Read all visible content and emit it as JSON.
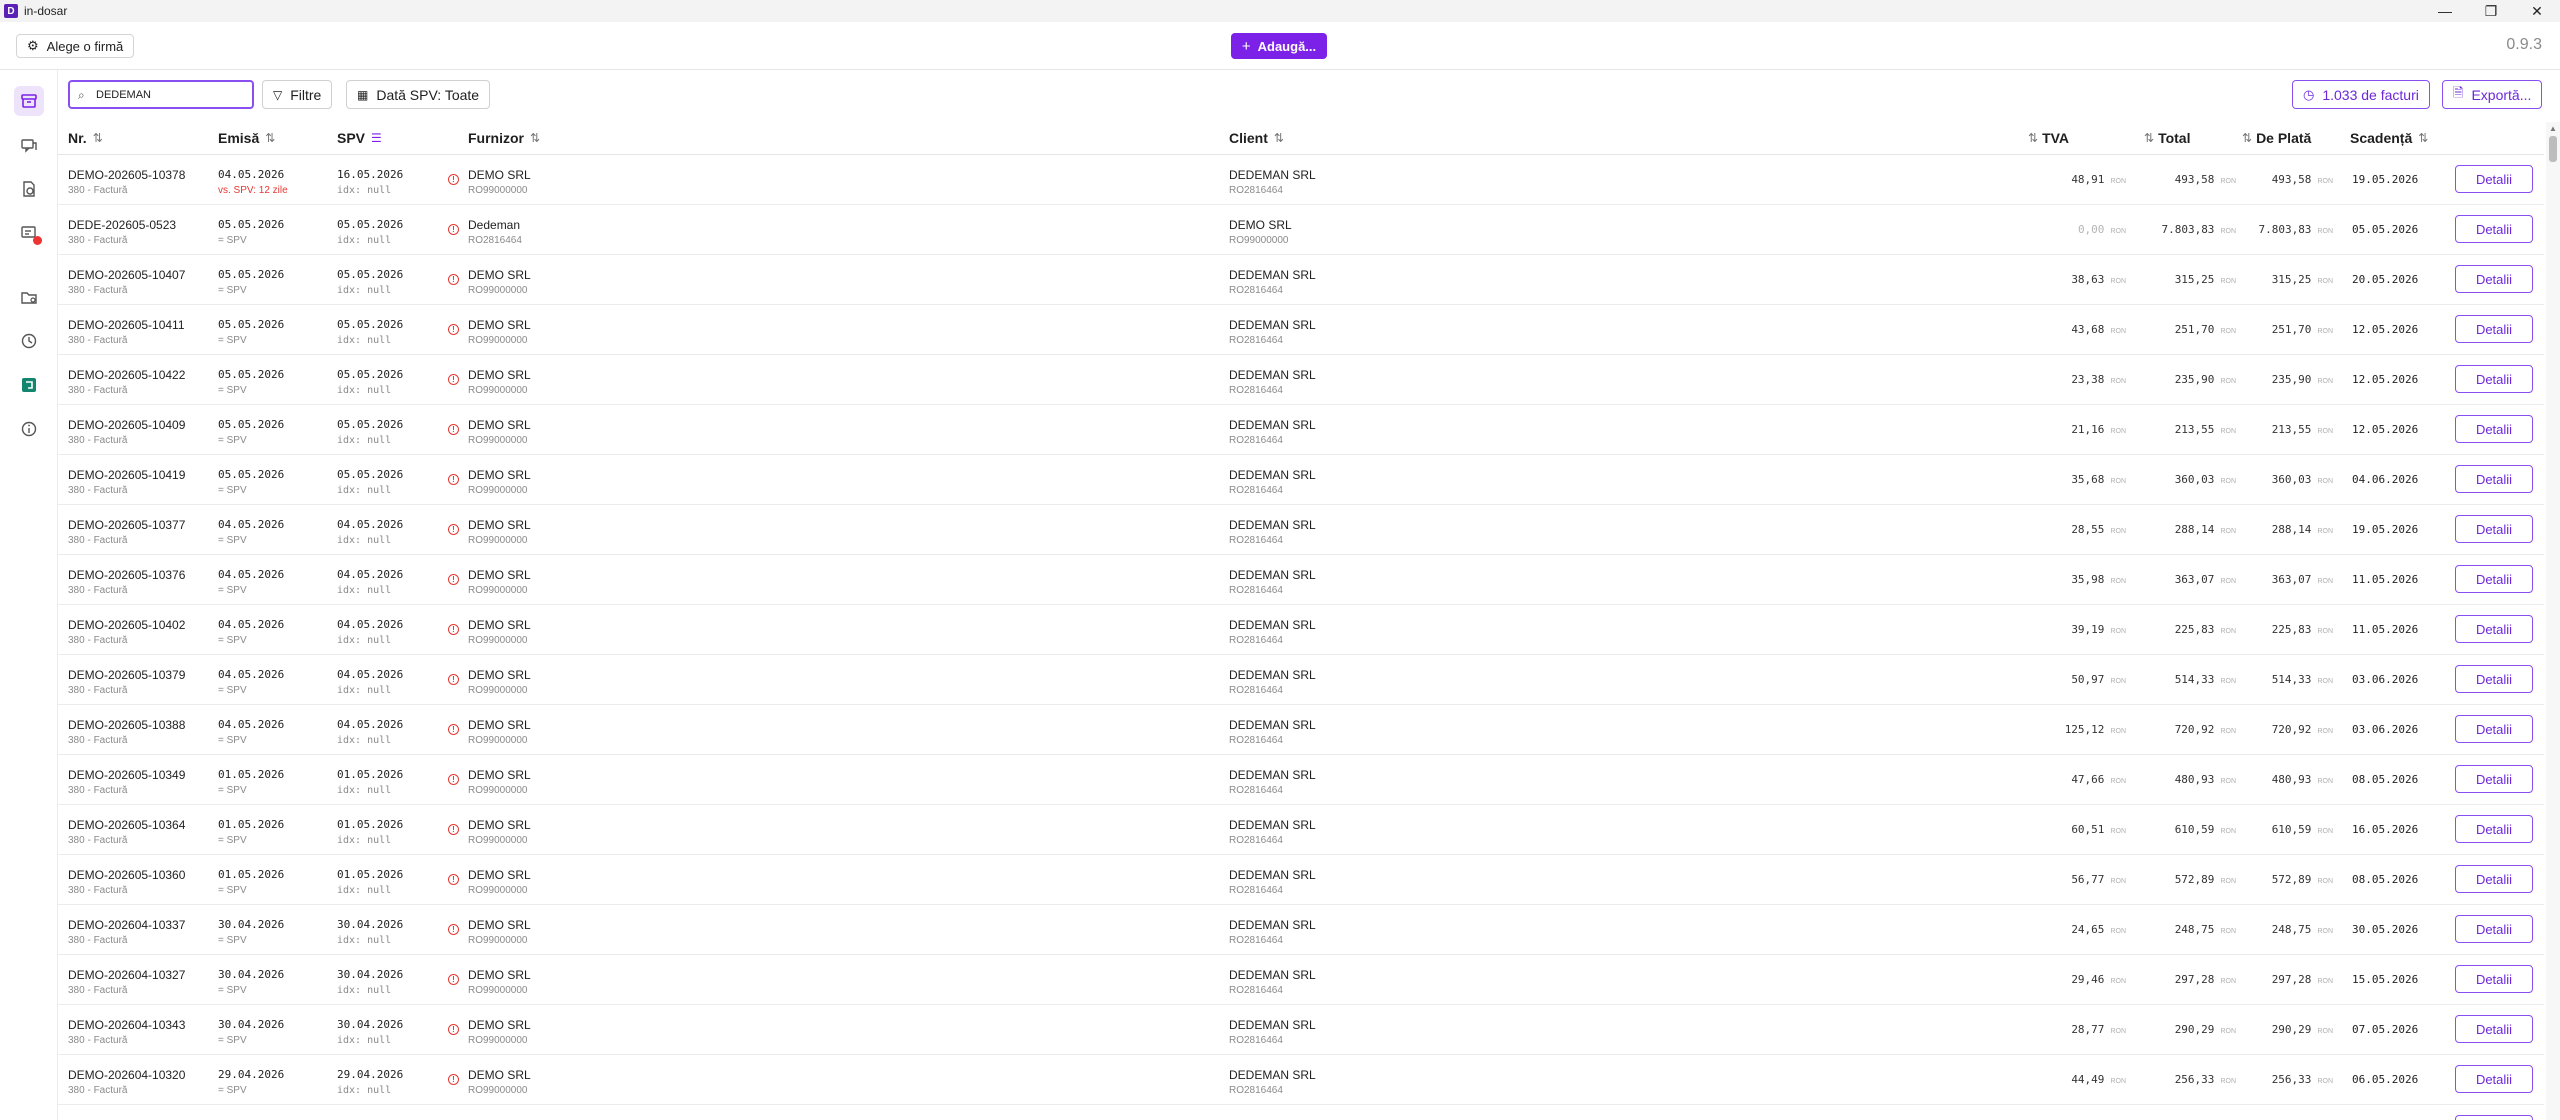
{
  "window": {
    "title": "in-dosar",
    "icon_glyph": "D",
    "controls": [
      "—",
      "❐",
      "✕"
    ]
  },
  "topbar": {
    "firm_button": "Alege o firmă",
    "add_button": "Adaugă...",
    "version": "0.9.3"
  },
  "toolbar": {
    "search_value": "DEDEMAN",
    "filters_label": "Filtre",
    "date_filter_label": "Dată SPV: Toate",
    "invoice_count_label": "1.033 de facturi",
    "export_label": "Exportă..."
  },
  "columns": {
    "nr": "Nr.",
    "emisa": "Emisă",
    "spv": "SPV",
    "furnizor": "Furnizor",
    "client": "Client",
    "tva": "TVA",
    "total": "Total",
    "de_plata": "De Plată",
    "scadenta": "Scadență"
  },
  "currency": "RON",
  "details_label": "Detalii",
  "rows": [
    {
      "nr": "DEMO-202605-10378",
      "type": "380 - Factură",
      "emisa": "04.05.2026",
      "emisa_note": "vs. SPV: 12 zile",
      "spv": "16.05.2026",
      "idx": "idx: null",
      "furnizor": "DEMO SRL",
      "furnizor_cif": "RO99000000",
      "client": "DEDEMAN SRL",
      "client_cif": "RO2816464",
      "tva": "48,91",
      "total": "493,58",
      "de_plata": "493,58",
      "scadenta": "19.05.2026"
    },
    {
      "nr": "DEDE-202605-0523",
      "type": "380 - Factură",
      "emisa": "05.05.2026",
      "emisa_note": "= SPV",
      "spv": "05.05.2026",
      "idx": "idx: null",
      "furnizor": "Dedeman",
      "furnizor_cif": "RO2816464",
      "client": "DEMO SRL",
      "client_cif": "RO99000000",
      "tva": "0,00",
      "total": "7.803,83",
      "de_plata": "7.803,83",
      "scadenta": "05.05.2026"
    },
    {
      "nr": "DEMO-202605-10407",
      "type": "380 - Factură",
      "emisa": "05.05.2026",
      "emisa_note": "= SPV",
      "spv": "05.05.2026",
      "idx": "idx: null",
      "furnizor": "DEMO SRL",
      "furnizor_cif": "RO99000000",
      "client": "DEDEMAN SRL",
      "client_cif": "RO2816464",
      "tva": "38,63",
      "total": "315,25",
      "de_plata": "315,25",
      "scadenta": "20.05.2026"
    },
    {
      "nr": "DEMO-202605-10411",
      "type": "380 - Factură",
      "emisa": "05.05.2026",
      "emisa_note": "= SPV",
      "spv": "05.05.2026",
      "idx": "idx: null",
      "furnizor": "DEMO SRL",
      "furnizor_cif": "RO99000000",
      "client": "DEDEMAN SRL",
      "client_cif": "RO2816464",
      "tva": "43,68",
      "total": "251,70",
      "de_plata": "251,70",
      "scadenta": "12.05.2026"
    },
    {
      "nr": "DEMO-202605-10422",
      "type": "380 - Factură",
      "emisa": "05.05.2026",
      "emisa_note": "= SPV",
      "spv": "05.05.2026",
      "idx": "idx: null",
      "furnizor": "DEMO SRL",
      "furnizor_cif": "RO99000000",
      "client": "DEDEMAN SRL",
      "client_cif": "RO2816464",
      "tva": "23,38",
      "total": "235,90",
      "de_plata": "235,90",
      "scadenta": "12.05.2026"
    },
    {
      "nr": "DEMO-202605-10409",
      "type": "380 - Factură",
      "emisa": "05.05.2026",
      "emisa_note": "= SPV",
      "spv": "05.05.2026",
      "idx": "idx: null",
      "furnizor": "DEMO SRL",
      "furnizor_cif": "RO99000000",
      "client": "DEDEMAN SRL",
      "client_cif": "RO2816464",
      "tva": "21,16",
      "total": "213,55",
      "de_plata": "213,55",
      "scadenta": "12.05.2026"
    },
    {
      "nr": "DEMO-202605-10419",
      "type": "380 - Factură",
      "emisa": "05.05.2026",
      "emisa_note": "= SPV",
      "spv": "05.05.2026",
      "idx": "idx: null",
      "furnizor": "DEMO SRL",
      "furnizor_cif": "RO99000000",
      "client": "DEDEMAN SRL",
      "client_cif": "RO2816464",
      "tva": "35,68",
      "total": "360,03",
      "de_plata": "360,03",
      "scadenta": "04.06.2026"
    },
    {
      "nr": "DEMO-202605-10377",
      "type": "380 - Factură",
      "emisa": "04.05.2026",
      "emisa_note": "= SPV",
      "spv": "04.05.2026",
      "idx": "idx: null",
      "furnizor": "DEMO SRL",
      "furnizor_cif": "RO99000000",
      "client": "DEDEMAN SRL",
      "client_cif": "RO2816464",
      "tva": "28,55",
      "total": "288,14",
      "de_plata": "288,14",
      "scadenta": "19.05.2026"
    },
    {
      "nr": "DEMO-202605-10376",
      "type": "380 - Factură",
      "emisa": "04.05.2026",
      "emisa_note": "= SPV",
      "spv": "04.05.2026",
      "idx": "idx: null",
      "furnizor": "DEMO SRL",
      "furnizor_cif": "RO99000000",
      "client": "DEDEMAN SRL",
      "client_cif": "RO2816464",
      "tva": "35,98",
      "total": "363,07",
      "de_plata": "363,07",
      "scadenta": "11.05.2026"
    },
    {
      "nr": "DEMO-202605-10402",
      "type": "380 - Factură",
      "emisa": "04.05.2026",
      "emisa_note": "= SPV",
      "spv": "04.05.2026",
      "idx": "idx: null",
      "furnizor": "DEMO SRL",
      "furnizor_cif": "RO99000000",
      "client": "DEDEMAN SRL",
      "client_cif": "RO2816464",
      "tva": "39,19",
      "total": "225,83",
      "de_plata": "225,83",
      "scadenta": "11.05.2026"
    },
    {
      "nr": "DEMO-202605-10379",
      "type": "380 - Factură",
      "emisa": "04.05.2026",
      "emisa_note": "= SPV",
      "spv": "04.05.2026",
      "idx": "idx: null",
      "furnizor": "DEMO SRL",
      "furnizor_cif": "RO99000000",
      "client": "DEDEMAN SRL",
      "client_cif": "RO2816464",
      "tva": "50,97",
      "total": "514,33",
      "de_plata": "514,33",
      "scadenta": "03.06.2026"
    },
    {
      "nr": "DEMO-202605-10388",
      "type": "380 - Factură",
      "emisa": "04.05.2026",
      "emisa_note": "= SPV",
      "spv": "04.05.2026",
      "idx": "idx: null",
      "furnizor": "DEMO SRL",
      "furnizor_cif": "RO99000000",
      "client": "DEDEMAN SRL",
      "client_cif": "RO2816464",
      "tva": "125,12",
      "total": "720,92",
      "de_plata": "720,92",
      "scadenta": "03.06.2026"
    },
    {
      "nr": "DEMO-202605-10349",
      "type": "380 - Factură",
      "emisa": "01.05.2026",
      "emisa_note": "= SPV",
      "spv": "01.05.2026",
      "idx": "idx: null",
      "furnizor": "DEMO SRL",
      "furnizor_cif": "RO99000000",
      "client": "DEDEMAN SRL",
      "client_cif": "RO2816464",
      "tva": "47,66",
      "total": "480,93",
      "de_plata": "480,93",
      "scadenta": "08.05.2026"
    },
    {
      "nr": "DEMO-202605-10364",
      "type": "380 - Factură",
      "emisa": "01.05.2026",
      "emisa_note": "= SPV",
      "spv": "01.05.2026",
      "idx": "idx: null",
      "furnizor": "DEMO SRL",
      "furnizor_cif": "RO99000000",
      "client": "DEDEMAN SRL",
      "client_cif": "RO2816464",
      "tva": "60,51",
      "total": "610,59",
      "de_plata": "610,59",
      "scadenta": "16.05.2026"
    },
    {
      "nr": "DEMO-202605-10360",
      "type": "380 - Factură",
      "emisa": "01.05.2026",
      "emisa_note": "= SPV",
      "spv": "01.05.2026",
      "idx": "idx: null",
      "furnizor": "DEMO SRL",
      "furnizor_cif": "RO99000000",
      "client": "DEDEMAN SRL",
      "client_cif": "RO2816464",
      "tva": "56,77",
      "total": "572,89",
      "de_plata": "572,89",
      "scadenta": "08.05.2026"
    },
    {
      "nr": "DEMO-202604-10337",
      "type": "380 - Factură",
      "emisa": "30.04.2026",
      "emisa_note": "= SPV",
      "spv": "30.04.2026",
      "idx": "idx: null",
      "furnizor": "DEMO SRL",
      "furnizor_cif": "RO99000000",
      "client": "DEDEMAN SRL",
      "client_cif": "RO2816464",
      "tva": "24,65",
      "total": "248,75",
      "de_plata": "248,75",
      "scadenta": "30.05.2026"
    },
    {
      "nr": "DEMO-202604-10327",
      "type": "380 - Factură",
      "emisa": "30.04.2026",
      "emisa_note": "= SPV",
      "spv": "30.04.2026",
      "idx": "idx: null",
      "furnizor": "DEMO SRL",
      "furnizor_cif": "RO99000000",
      "client": "DEDEMAN SRL",
      "client_cif": "RO2816464",
      "tva": "29,46",
      "total": "297,28",
      "de_plata": "297,28",
      "scadenta": "15.05.2026"
    },
    {
      "nr": "DEMO-202604-10343",
      "type": "380 - Factură",
      "emisa": "30.04.2026",
      "emisa_note": "= SPV",
      "spv": "30.04.2026",
      "idx": "idx: null",
      "furnizor": "DEMO SRL",
      "furnizor_cif": "RO99000000",
      "client": "DEDEMAN SRL",
      "client_cif": "RO2816464",
      "tva": "28,77",
      "total": "290,29",
      "de_plata": "290,29",
      "scadenta": "07.05.2026"
    },
    {
      "nr": "DEMO-202604-10320",
      "type": "380 - Factură",
      "emisa": "29.04.2026",
      "emisa_note": "= SPV",
      "spv": "29.04.2026",
      "idx": "idx: null",
      "furnizor": "DEMO SRL",
      "furnizor_cif": "RO99000000",
      "client": "DEDEMAN SRL",
      "client_cif": "RO2816464",
      "tva": "44,49",
      "total": "256,33",
      "de_plata": "256,33",
      "scadenta": "06.05.2026"
    }
  ],
  "colors": {
    "accent": "#7c22e8",
    "warning": "#e53935",
    "muted": "#8a8a8a"
  }
}
